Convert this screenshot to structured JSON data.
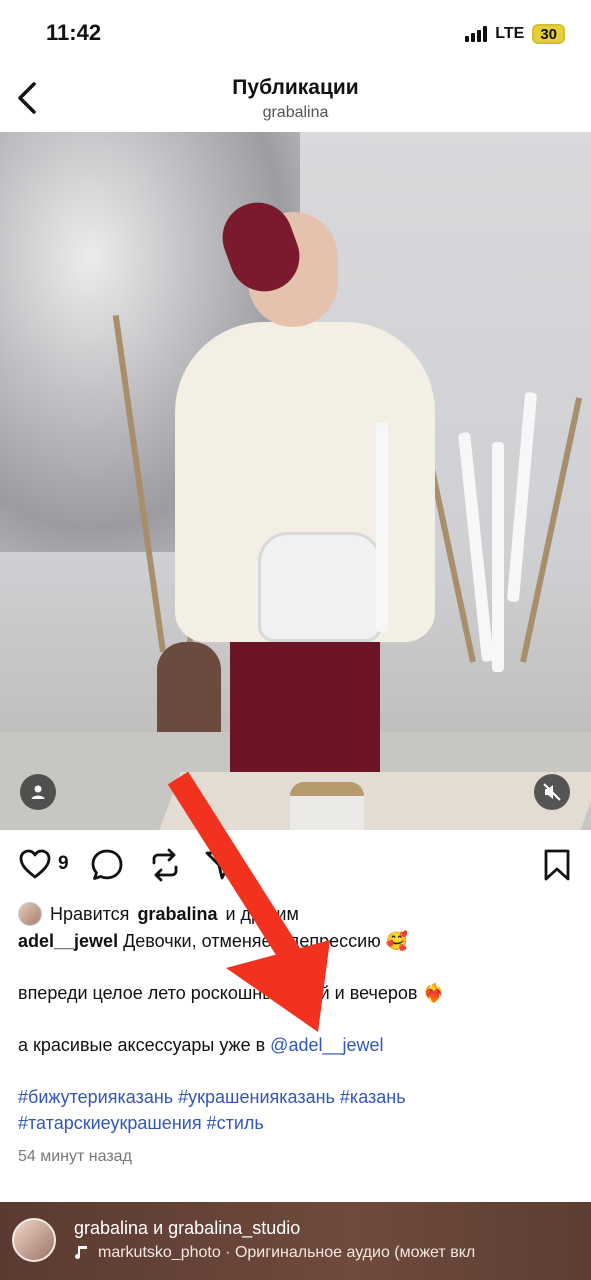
{
  "status_bar": {
    "time": "11:42",
    "network": "LTE",
    "battery": "30"
  },
  "nav": {
    "title": "Публикации",
    "subtitle": "grabalina",
    "back_icon": "chevron-left-icon"
  },
  "actions": {
    "like_count": "9"
  },
  "caption": {
    "likes_prefix": "Нравится",
    "likes_user": "grabalina",
    "likes_suffix": "и другим",
    "author": "adel__jewel",
    "line1": "Девочки, отменяем депрессию 🥰",
    "line2": "впереди целое лето роскошных дней и вечеров ❤️‍🔥",
    "line3_text": "а красивые аксессуары уже в",
    "line3_mention": "@adel__jewel",
    "hashtags_line1": "#бижутерияказань #украшенияказань #казань",
    "hashtags_line2": "#татарскиеукрашения #стиль",
    "time_ago": "54 минут назад"
  },
  "audio": {
    "user1": "grabalina",
    "conj": "и",
    "user2": "grabalina_studio",
    "track": "markutsko_photo · Оригинальное аудио (может вкл"
  },
  "colors": {
    "link": "#3357b8",
    "arrow": "#f0321e",
    "audio_bar": "#5b3a31"
  }
}
